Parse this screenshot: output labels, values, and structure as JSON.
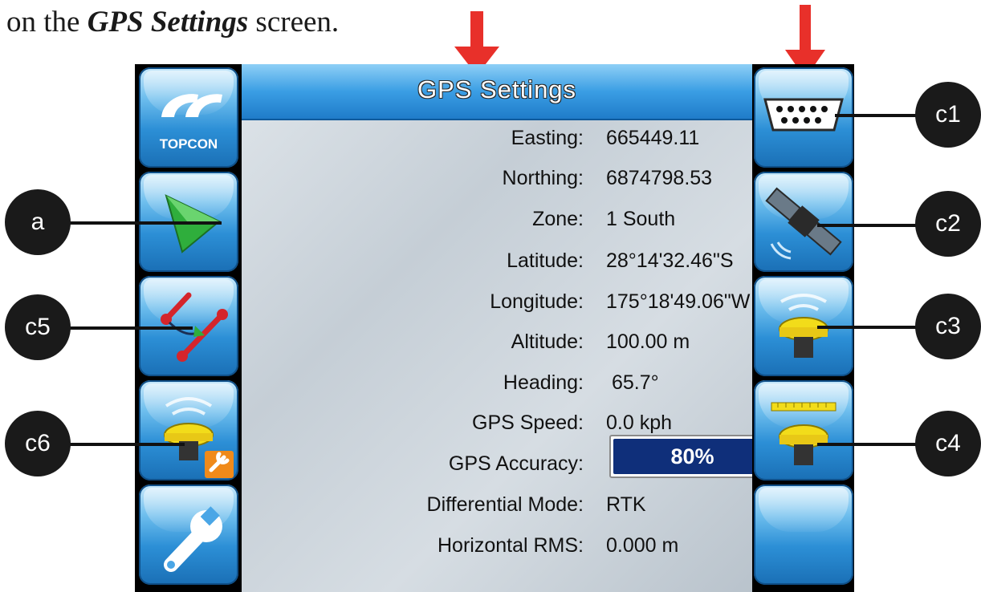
{
  "caption": {
    "prefix": "on the",
    "emphasis": "GPS Settings",
    "suffix": "screen."
  },
  "screen": {
    "title": "GPS Settings",
    "brand": "TOPCON",
    "rows": [
      {
        "label": "Easting:",
        "value": "665449.11"
      },
      {
        "label": "Northing:",
        "value": "6874798.53"
      },
      {
        "label": "Zone:",
        "value": "1 South"
      },
      {
        "label": "Latitude:",
        "value": "28°14'32.46\"S"
      },
      {
        "label": "Longitude:",
        "value": "175°18'49.06\"W"
      },
      {
        "label": "Altitude:",
        "value": "100.00 m"
      },
      {
        "label": "Heading:",
        "value": " 65.7°"
      },
      {
        "label": "GPS Speed:",
        "value": "0.0 kph"
      },
      {
        "label": "GPS Accuracy:",
        "value": ""
      },
      {
        "label": "Differential Mode:",
        "value": "RTK"
      },
      {
        "label": "Horizontal RMS:",
        "value": "0.000 m"
      }
    ],
    "accuracy": {
      "text": "80%",
      "fraction": 0.8
    }
  },
  "left_buttons": [
    {
      "icon": "topcon-logo-icon"
    },
    {
      "icon": "guidance-arrow-icon"
    },
    {
      "icon": "implement-offset-icon"
    },
    {
      "icon": "receiver-settings-icon"
    },
    {
      "icon": "wrench-icon"
    }
  ],
  "right_buttons": [
    {
      "icon": "serial-port-icon"
    },
    {
      "icon": "satellite-icon"
    },
    {
      "icon": "gps-receiver-icon"
    },
    {
      "icon": "receiver-ruler-icon"
    },
    {
      "icon": "empty"
    }
  ],
  "callouts": {
    "a": "a",
    "c1": "c1",
    "c2": "c2",
    "c3": "c3",
    "c4": "c4",
    "c5": "c5",
    "c6": "c6"
  },
  "colors": {
    "accent_blue": "#2c8fd6",
    "arrow_red": "#e8302a",
    "accuracy_fill": "#0f2f7a"
  }
}
